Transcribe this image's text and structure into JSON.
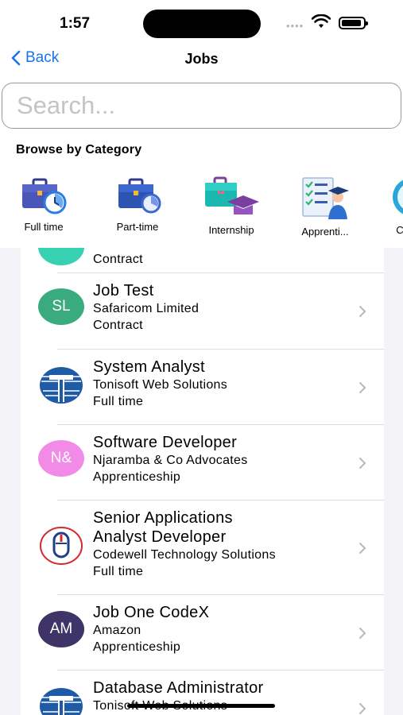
{
  "status_bar": {
    "time": "1:57"
  },
  "nav": {
    "back_label": "Back",
    "title": "Jobs"
  },
  "search": {
    "placeholder": "Search..."
  },
  "browse": {
    "title": "Browse by Category",
    "categories": [
      {
        "label": "Full time",
        "icon": "briefcase-clock-icon"
      },
      {
        "label": "Part-time",
        "icon": "briefcase-timer-icon"
      },
      {
        "label": "Internship",
        "icon": "briefcase-gradcap-icon"
      },
      {
        "label": "Apprenti...",
        "icon": "graduate-checklist-icon"
      },
      {
        "label": "C",
        "icon": "contract-icon"
      }
    ]
  },
  "jobs": {
    "partial_top": {
      "type": "Contract"
    },
    "items": [
      {
        "title": "Job Test",
        "company": "Safaricom Limited",
        "type": "Contract",
        "avatar_text": "SL",
        "avatar_color": "#3aaa7f"
      },
      {
        "title": "System Analyst",
        "company": "Tonisoft Web Solutions",
        "type": "Full time",
        "logo": "tonisoft-logo-icon"
      },
      {
        "title": "Software Developer",
        "company": "Njaramba & Co Advocates",
        "type": "Apprenticeship",
        "avatar_text": "N&",
        "avatar_color": "#f28be8"
      },
      {
        "title": "Senior Applications Analyst Developer",
        "title_line1": "Senior Applications",
        "title_line2": "Analyst Developer",
        "company": "Codewell Technology Solutions",
        "type": "Full time",
        "logo": "codewell-mouse-logo-icon"
      },
      {
        "title": "Job One CodeX",
        "company": "Amazon",
        "type": "Apprenticeship",
        "avatar_text": "AM",
        "avatar_color": "#3e3468"
      },
      {
        "title": "Database Administrator",
        "company": "Tonisoft Web Solutions",
        "logo": "tonisoft-logo-icon"
      }
    ]
  },
  "colors": {
    "accent": "#1a73e8",
    "background": "#f2f2f7",
    "tonisoft_blue": "#1f5aa6",
    "codewell_red": "#d6282e"
  }
}
